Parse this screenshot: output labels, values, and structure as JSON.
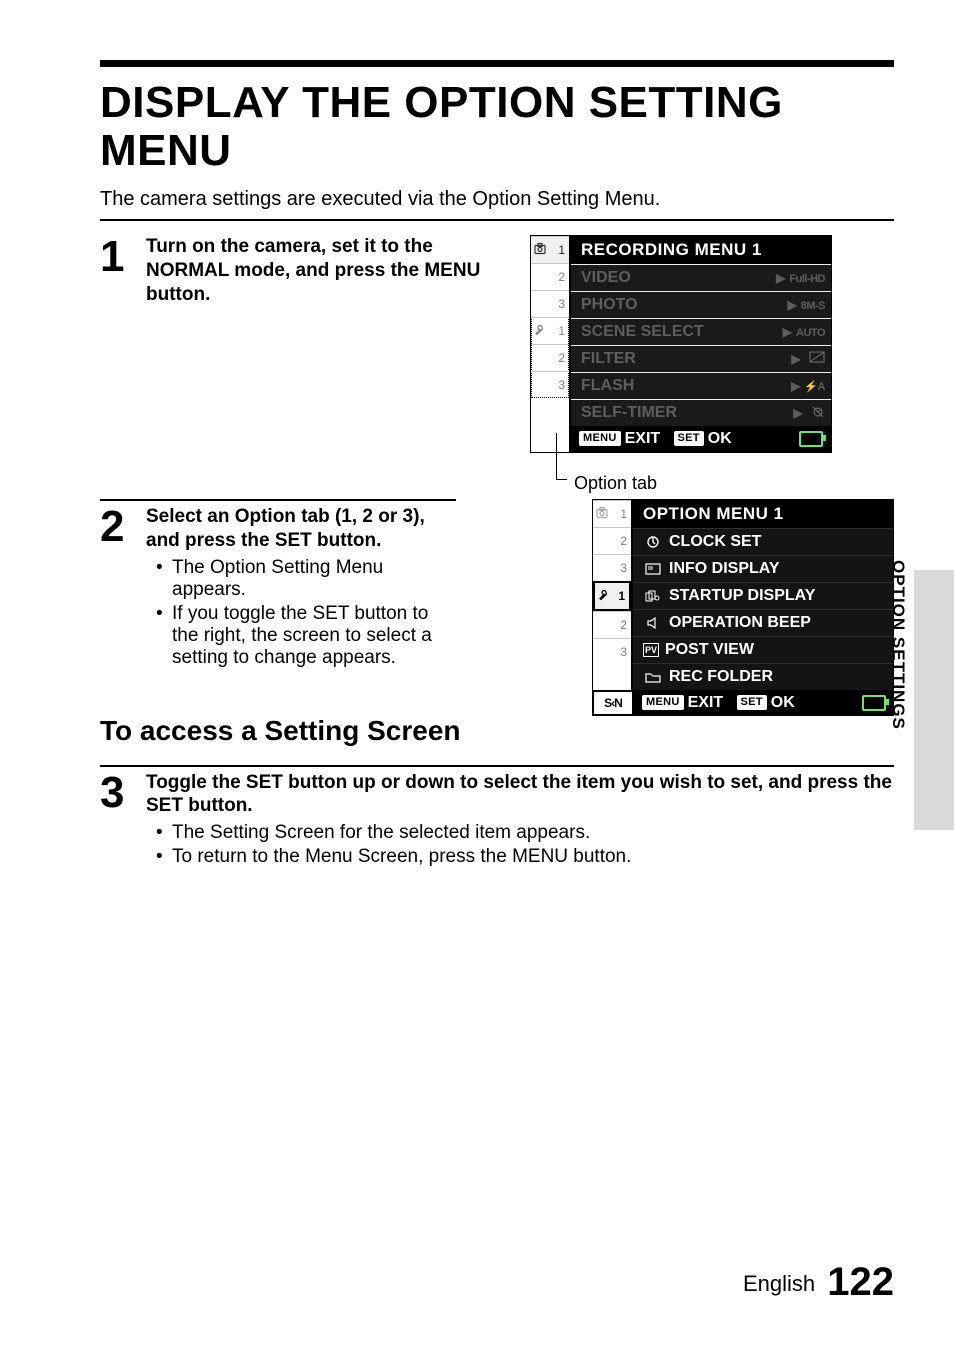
{
  "title_line1": "DISPLAY THE OPTION SETTING",
  "title_line2": "MENU",
  "intro": "The camera settings are executed via the Option Setting Menu.",
  "side_label": "OPTION SETTINGS",
  "footer_lang": "English",
  "footer_page": "122",
  "step1": {
    "num": "1",
    "instr": "Turn on the camera, set it to the NORMAL mode, and press the MENU button."
  },
  "ui1": {
    "title": "RECORDING MENU 1",
    "tabs_camera": [
      "1",
      "2",
      "3"
    ],
    "tabs_option": [
      "1",
      "2",
      "3"
    ],
    "rows": [
      {
        "label": "VIDEO",
        "value": "Full-HD"
      },
      {
        "label": "PHOTO",
        "value": "8M-S"
      },
      {
        "label": "SCENE SELECT",
        "value": "AUTO"
      },
      {
        "label": "FILTER",
        "value": ""
      },
      {
        "label": "FLASH",
        "value": "⚡A"
      },
      {
        "label": "SELF-TIMER",
        "value": ""
      }
    ],
    "footer_menu_pill": "MENU",
    "footer_exit": "EXIT",
    "footer_set_pill": "SET",
    "footer_ok": "OK",
    "caption": "Option tab"
  },
  "step2": {
    "num": "2",
    "instr": "Select an Option tab (1, 2 or 3), and press the SET button.",
    "bullet1": "The Option Setting Menu appears.",
    "bullet2": "If you toggle the SET button to the right, the screen to select a setting to change appears."
  },
  "ui2": {
    "title": "OPTION MENU 1",
    "tabs_camera": [
      "1",
      "2",
      "3"
    ],
    "tabs_option": [
      "1",
      "2",
      "3"
    ],
    "rows": [
      {
        "icon": "clock",
        "label": "CLOCK SET"
      },
      {
        "icon": "screen",
        "label": "INFO DISPLAY"
      },
      {
        "icon": "startup",
        "label": "STARTUP DISPLAY"
      },
      {
        "icon": "speaker",
        "label": "OPERATION BEEP"
      },
      {
        "icon": "pv",
        "label": "POST VIEW"
      },
      {
        "icon": "folder",
        "label": "REC FOLDER"
      }
    ],
    "sn_badge": "S‹N",
    "footer_menu_pill": "MENU",
    "footer_exit": "EXIT",
    "footer_set_pill": "SET",
    "footer_ok": "OK"
  },
  "subheading": "To access a Setting Screen",
  "step3": {
    "num": "3",
    "instr": "Toggle the SET button up or down to select the item you wish to set, and press the SET button.",
    "bullet1": "The Setting Screen for the selected item appears.",
    "bullet2": "To return to the Menu Screen, press the MENU button."
  }
}
